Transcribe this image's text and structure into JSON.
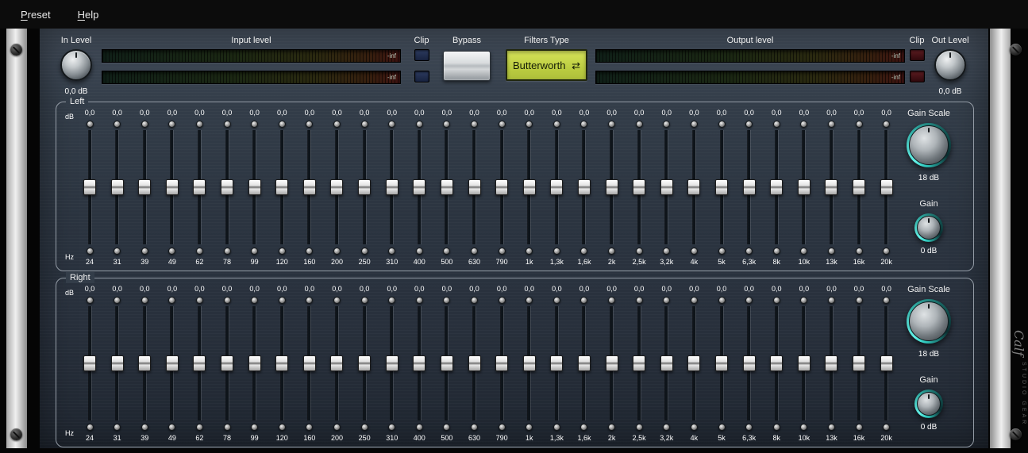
{
  "menu": {
    "items": [
      {
        "label": "Preset"
      },
      {
        "label": "Help"
      }
    ]
  },
  "top_bar": {
    "in_level": {
      "label": "In Level",
      "value": "0,0 dB"
    },
    "input_meter": {
      "label": "Input level",
      "channels": [
        {
          "readout": "-inf"
        },
        {
          "readout": "-inf"
        }
      ]
    },
    "input_clip": {
      "label": "Clip"
    },
    "bypass": {
      "label": "Bypass"
    },
    "filters_type": {
      "label": "Filters Type",
      "value": "Butterworth",
      "icon_glyph": "⇄"
    },
    "output_meter": {
      "label": "Output level",
      "channels": [
        {
          "readout": "-inf"
        },
        {
          "readout": "-inf"
        }
      ]
    },
    "output_clip": {
      "label": "Clip"
    },
    "out_level": {
      "label": "Out Level",
      "value": "0,0 dB"
    }
  },
  "bands": {
    "db_unit": "dB",
    "hz_unit": "Hz",
    "frequencies": [
      "24",
      "31",
      "39",
      "49",
      "62",
      "78",
      "99",
      "120",
      "160",
      "200",
      "250",
      "310",
      "400",
      "500",
      "630",
      "790",
      "1k",
      "1,3k",
      "1,6k",
      "2k",
      "2,5k",
      "3,2k",
      "4k",
      "5k",
      "6,3k",
      "8k",
      "10k",
      "13k",
      "16k",
      "20k"
    ],
    "values": [
      "0,0",
      "0,0",
      "0,0",
      "0,0",
      "0,0",
      "0,0",
      "0,0",
      "0,0",
      "0,0",
      "0,0",
      "0,0",
      "0,0",
      "0,0",
      "0,0",
      "0,0",
      "0,0",
      "0,0",
      "0,0",
      "0,0",
      "0,0",
      "0,0",
      "0,0",
      "0,0",
      "0,0",
      "0,0",
      "0,0",
      "0,0",
      "0,0",
      "0,0",
      "0,0"
    ],
    "sections": [
      {
        "label": "Left",
        "gain_scale_label": "Gain Scale",
        "gain_scale_value": "18 dB",
        "gain_label": "Gain",
        "gain_value": "0 dB"
      },
      {
        "label": "Right",
        "gain_scale_label": "Gain Scale",
        "gain_scale_value": "18 dB",
        "gain_label": "Gain",
        "gain_value": "0 dB"
      }
    ]
  },
  "branding": {
    "logo": "Calf",
    "tagline": "studio gear"
  },
  "colors": {
    "accent_teal": "#45e0d6",
    "lcd_background": "#c9d84d",
    "clip_in_led": "#24304f",
    "clip_out_led": "#4a161a",
    "panel": "#2f3945",
    "rail": "#e0e0e0"
  }
}
